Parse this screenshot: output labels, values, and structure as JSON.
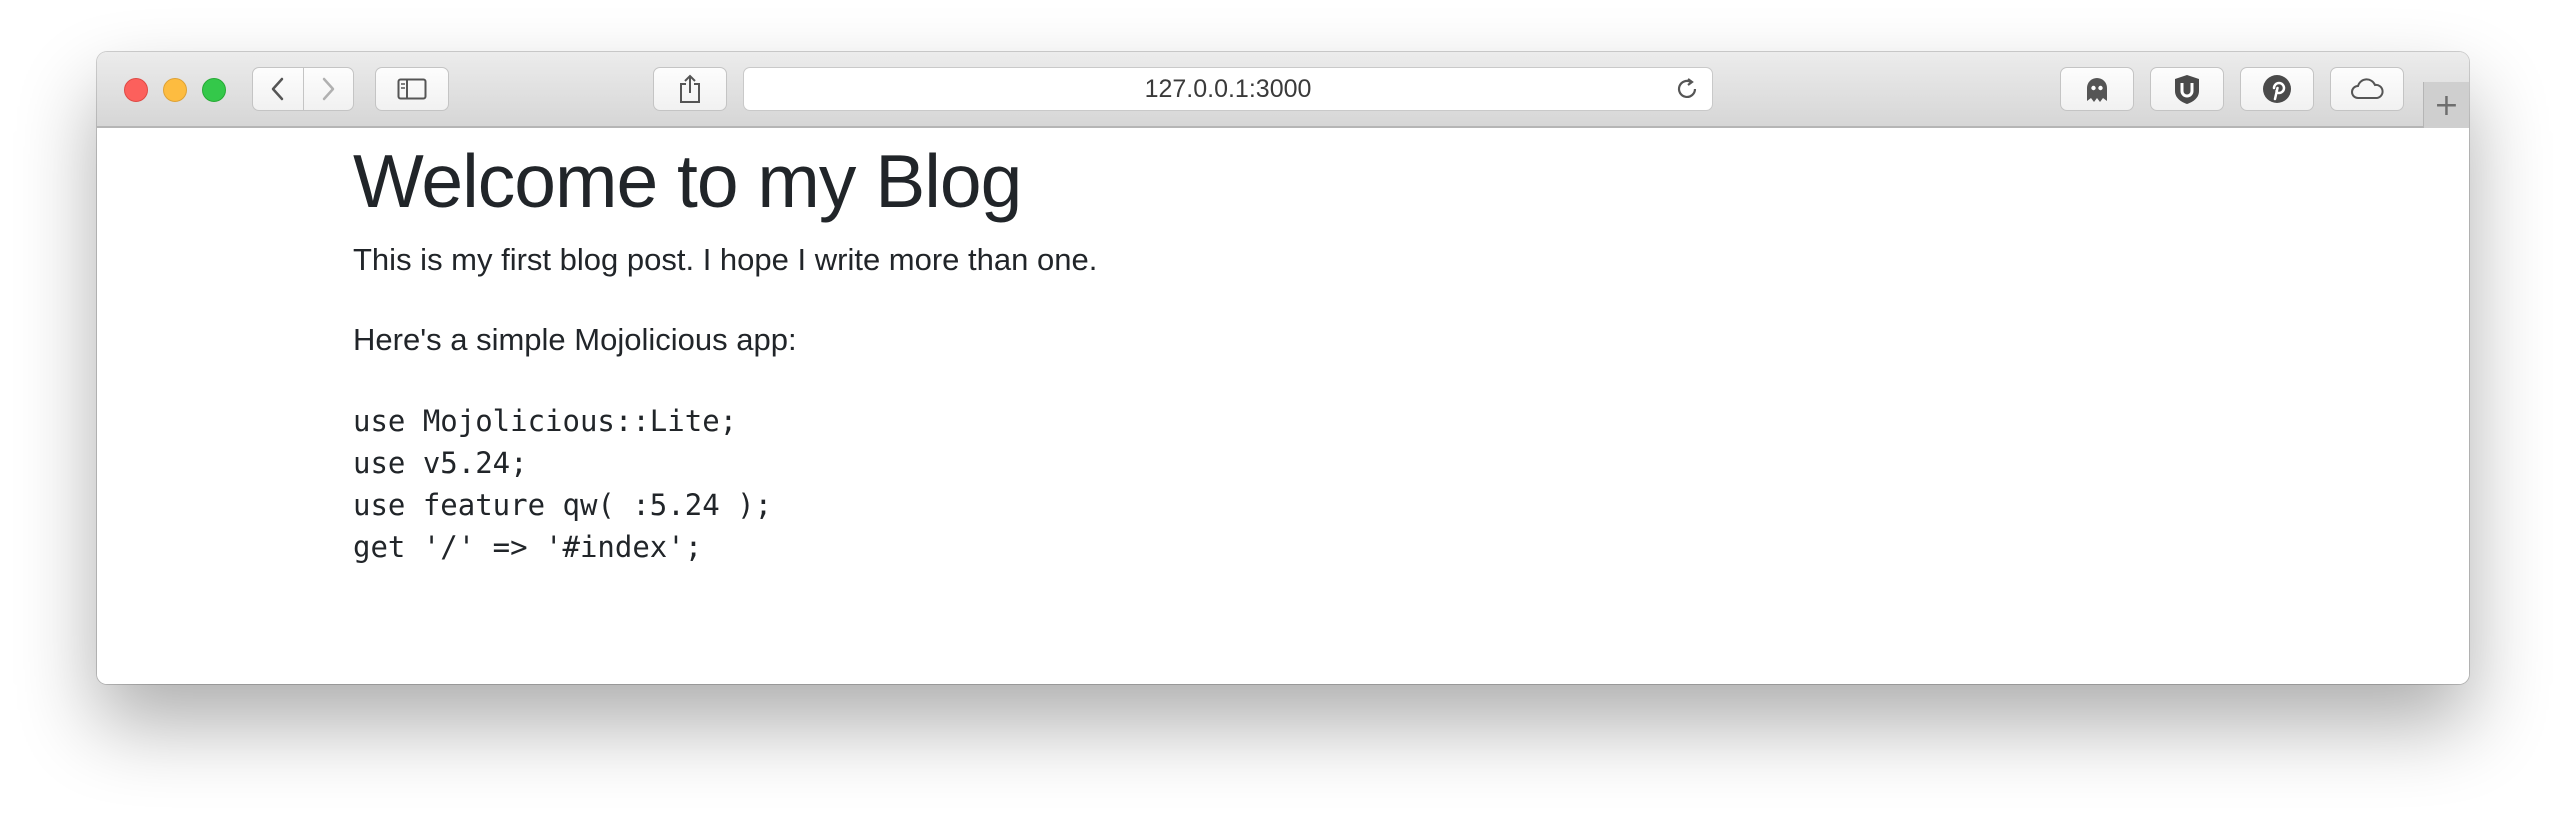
{
  "browser": {
    "url": "127.0.0.1:3000",
    "new_tab_label": "+",
    "icons": {
      "back": "chevron-left-icon",
      "forward": "chevron-right-icon",
      "sidebar": "sidebar-icon",
      "share": "share-icon",
      "reload": "reload-icon",
      "ghostery": "ghost-icon",
      "ublock": "ublock-icon",
      "pinterest": "pinterest-icon",
      "cloud": "cloud-icon"
    },
    "colors": {
      "close": "#fc605c",
      "minimize": "#fdbc40",
      "zoom": "#34c84a"
    }
  },
  "page": {
    "heading": "Welcome to my Blog",
    "paragraph1": "This is my first blog post. I hope I write more than one.",
    "paragraph2": "Here's a simple Mojolicious app:",
    "code_lines": [
      "use Mojolicious::Lite;",
      "use v5.24;",
      "use feature qw( :5.24 );",
      "get '/' => '#index';"
    ]
  }
}
